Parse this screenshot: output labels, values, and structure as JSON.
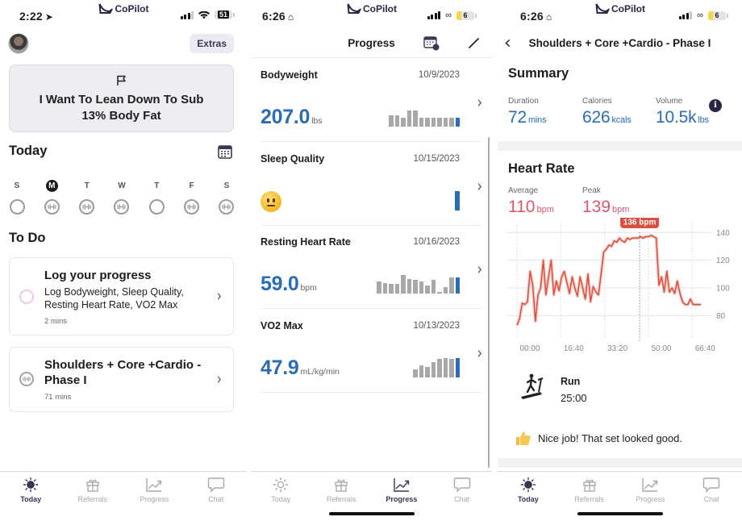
{
  "screens": {
    "today": {
      "status": {
        "time": "2:22",
        "time_glyph": "location-arrow",
        "battery": "51"
      },
      "brand": "CoPilot",
      "extras_label": "Extras",
      "goal": {
        "icon": "flag-icon",
        "text": "I Want To Lean Down To Sub 13% Body Fat"
      },
      "today_title": "Today",
      "week": [
        {
          "label": "S",
          "selected": false,
          "workout": false
        },
        {
          "label": "M",
          "selected": true,
          "workout": true
        },
        {
          "label": "T",
          "selected": false,
          "workout": true
        },
        {
          "label": "W",
          "selected": false,
          "workout": true
        },
        {
          "label": "T",
          "selected": false,
          "workout": false
        },
        {
          "label": "F",
          "selected": false,
          "workout": true
        },
        {
          "label": "S",
          "selected": false,
          "workout": true
        }
      ],
      "todo_title": "To Do",
      "todos": [
        {
          "title": "Log your progress",
          "subtitle": "Log Bodyweight, Sleep Quality, Resting Heart Rate, VO2 Max",
          "meta": "2 mins"
        },
        {
          "title": "Shoulders + Core +Cardio - Phase I",
          "meta": "71 mins"
        }
      ]
    },
    "progress": {
      "status": {
        "time": "6:26",
        "time_glyph": "home",
        "battery": "6"
      },
      "brand": "CoPilot",
      "title": "Progress",
      "metrics": [
        {
          "name": "Bodyweight",
          "date": "10/9/2023",
          "value": "207.0",
          "unit": "lbs",
          "spark": [
            0.6,
            0.6,
            0.45,
            0.85,
            0.85,
            0.45,
            0.45,
            0.45,
            0.45,
            0.45,
            0.45,
            0.45
          ]
        },
        {
          "name": "Sleep Quality",
          "date": "10/15/2023",
          "emoji": "neutral-face",
          "spark": [
            1.0
          ]
        },
        {
          "name": "Resting Heart Rate",
          "date": "10/16/2023",
          "value": "59.0",
          "unit": "bpm",
          "spark": [
            0.62,
            0.55,
            0.5,
            0.5,
            0.95,
            0.75,
            0.7,
            0.62,
            0.4,
            0.72,
            0.1,
            0.33,
            0.82,
            0.82
          ]
        },
        {
          "name": "VO2 Max",
          "date": "10/13/2023",
          "value": "47.9",
          "unit": "mL/kg/min",
          "spark": [
            0.38,
            0.6,
            0.52,
            0.76,
            0.93,
            0.98,
            0.95,
            0.98
          ]
        }
      ]
    },
    "workout": {
      "status": {
        "time": "6:26",
        "time_glyph": "home",
        "battery": "6"
      },
      "brand": "CoPilot",
      "title": "Shoulders + Core +Cardio - Phase I",
      "summary_title": "Summary",
      "summary": {
        "duration": {
          "label": "Duration",
          "value": "72",
          "unit": "mins"
        },
        "calories": {
          "label": "Calories",
          "value": "626",
          "unit": "kcals"
        },
        "volume": {
          "label": "Volume",
          "value": "10.5k",
          "unit": "lbs"
        }
      },
      "heart_rate_title": "Heart Rate",
      "average": {
        "label": "Average",
        "value": "110",
        "unit": "bpm"
      },
      "peak": {
        "label": "Peak",
        "value": "139",
        "unit": "bpm"
      },
      "exercise": {
        "name": "Run",
        "time": "25:00"
      },
      "feedback": "Nice job! That set looked good."
    }
  },
  "tabs": [
    "Today",
    "Referrals",
    "Progress",
    "Chat"
  ],
  "colors": {
    "brand_dark": "#2e2446",
    "metric_blue": "#2a6db5",
    "heart_red": "#d9503f",
    "hr_pink": "#e0566b"
  },
  "chart_data": {
    "type": "line",
    "title": "Heart Rate",
    "xlabel": "",
    "ylabel": "bpm",
    "x_ticks": [
      "00:00",
      "16:40",
      "33:20",
      "50:00",
      "66:40"
    ],
    "x_tick_seconds": [
      0,
      1000,
      2000,
      3000,
      4000
    ],
    "y_ticks": [
      80,
      100,
      120,
      140
    ],
    "ylim": [
      68,
      146
    ],
    "xlim": [
      0,
      4400
    ],
    "tooltip": {
      "label": "136 bpm",
      "x": 2800
    },
    "series": [
      {
        "name": "Heart Rate",
        "x": [
          0,
          60,
          120,
          180,
          240,
          300,
          360,
          420,
          480,
          540,
          600,
          660,
          720,
          780,
          840,
          900,
          960,
          1020,
          1080,
          1140,
          1200,
          1260,
          1320,
          1380,
          1440,
          1500,
          1560,
          1620,
          1680,
          1740,
          1800,
          1860,
          1920,
          1980,
          2040,
          2100,
          2160,
          2220,
          2280,
          2340,
          2400,
          2460,
          2520,
          2580,
          2640,
          2700,
          2760,
          2820,
          2880,
          2940,
          3000,
          3060,
          3120,
          3180,
          3240,
          3300,
          3360,
          3420,
          3480,
          3540,
          3600,
          3660,
          3720,
          3780,
          3840,
          3900,
          3960,
          4020,
          4080,
          4140,
          4200
        ],
        "values": [
          73,
          78,
          89,
          88,
          90,
          112,
          102,
          76,
          95,
          100,
          120,
          95,
          108,
          120,
          95,
          105,
          98,
          108,
          112,
          104,
          96,
          108,
          100,
          94,
          108,
          100,
          92,
          110,
          90,
          101,
          97,
          95,
          110,
          126,
          128,
          131,
          130,
          134,
          133,
          136,
          134,
          133,
          136,
          135,
          136,
          136,
          136,
          137,
          136,
          137,
          137,
          138,
          137,
          136,
          102,
          108,
          97,
          112,
          97,
          100,
          96,
          105,
          96,
          90,
          88,
          88,
          92,
          88,
          88,
          88,
          88
        ]
      }
    ]
  }
}
